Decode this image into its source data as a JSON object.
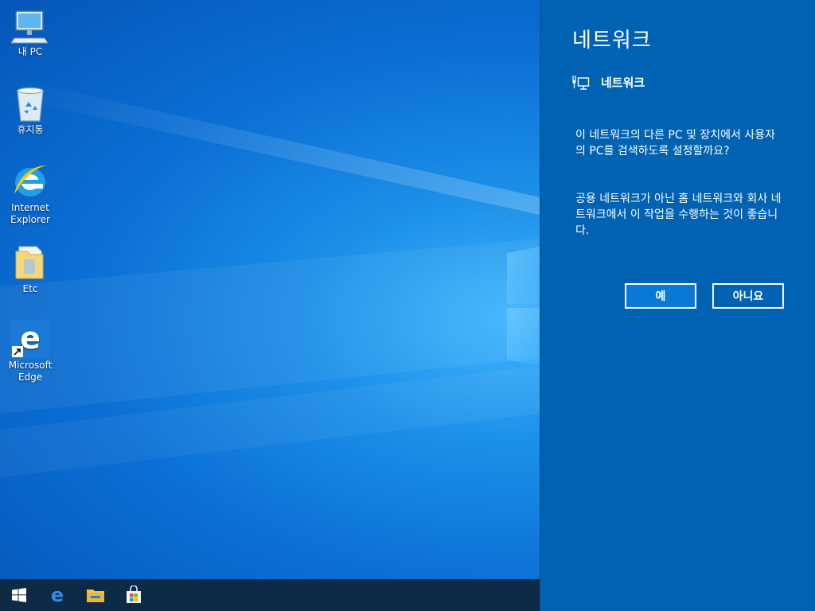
{
  "desktop": {
    "icons": [
      {
        "label": "내 PC",
        "icon": "computer-icon"
      },
      {
        "label": "휴지통",
        "icon": "recycle-bin-icon"
      },
      {
        "label": "Internet\nExplorer",
        "icon": "internet-explorer-icon"
      },
      {
        "label": "Etc",
        "icon": "folder-icon"
      },
      {
        "label": "Microsoft\nEdge",
        "icon": "edge-icon"
      }
    ]
  },
  "taskbar": {
    "items": [
      "start-icon",
      "edge-icon",
      "file-explorer-icon",
      "store-icon"
    ]
  },
  "flyout": {
    "title": "네트워크",
    "network_name": "네트워크",
    "message1": "이 네트워크의 다른 PC 및 장치에서 사용자의 PC를 검색하도록 설정할까요?",
    "message2": "공용 네트워크가 아닌 홈 네트워크와 회사 네트워크에서 이 작업을 수행하는 것이 좋습니다.",
    "yes_label": "예",
    "no_label": "아니요"
  },
  "colors": {
    "flyout_bg": "#0062b3",
    "accent": "#0a78d7",
    "taskbar": "#0d2a47"
  }
}
